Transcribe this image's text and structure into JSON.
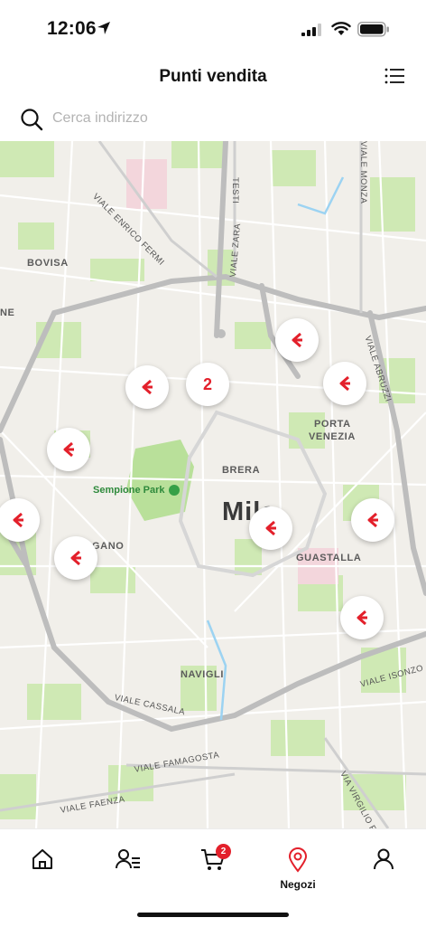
{
  "status": {
    "time": "12:06"
  },
  "header": {
    "title": "Punti vendita"
  },
  "search": {
    "placeholder": "Cerca indirizzo",
    "value": ""
  },
  "map": {
    "areas": [
      "BOVISA",
      "NE",
      "BRERA",
      "PORTA",
      "VENEZIA",
      "GUASTALLA",
      "NAVIGLI",
      "GANO"
    ],
    "city": "Mila",
    "park": "Sempione Park",
    "roads": [
      "VIALE ENRICO FERMI",
      "VIALE ZARA",
      "TESTI",
      "VIALE MONZA",
      "VIALE ABRUZZI",
      "VIALE ISONZO",
      "VIALE CASSALA",
      "VIALE FAMAGOSTA",
      "VIALE FAENZA",
      "VIA VIRGILIO F"
    ],
    "cluster_count": "2",
    "brand_color": "#e3202b"
  },
  "tabs": [
    {
      "id": "home",
      "icon": "home-icon",
      "label": ""
    },
    {
      "id": "list",
      "icon": "user-list-icon",
      "label": ""
    },
    {
      "id": "cart",
      "icon": "cart-icon",
      "label": "",
      "badge": "2"
    },
    {
      "id": "stores",
      "icon": "location-pin-icon",
      "label": "Negozi",
      "active": true
    },
    {
      "id": "profile",
      "icon": "user-icon",
      "label": ""
    }
  ]
}
